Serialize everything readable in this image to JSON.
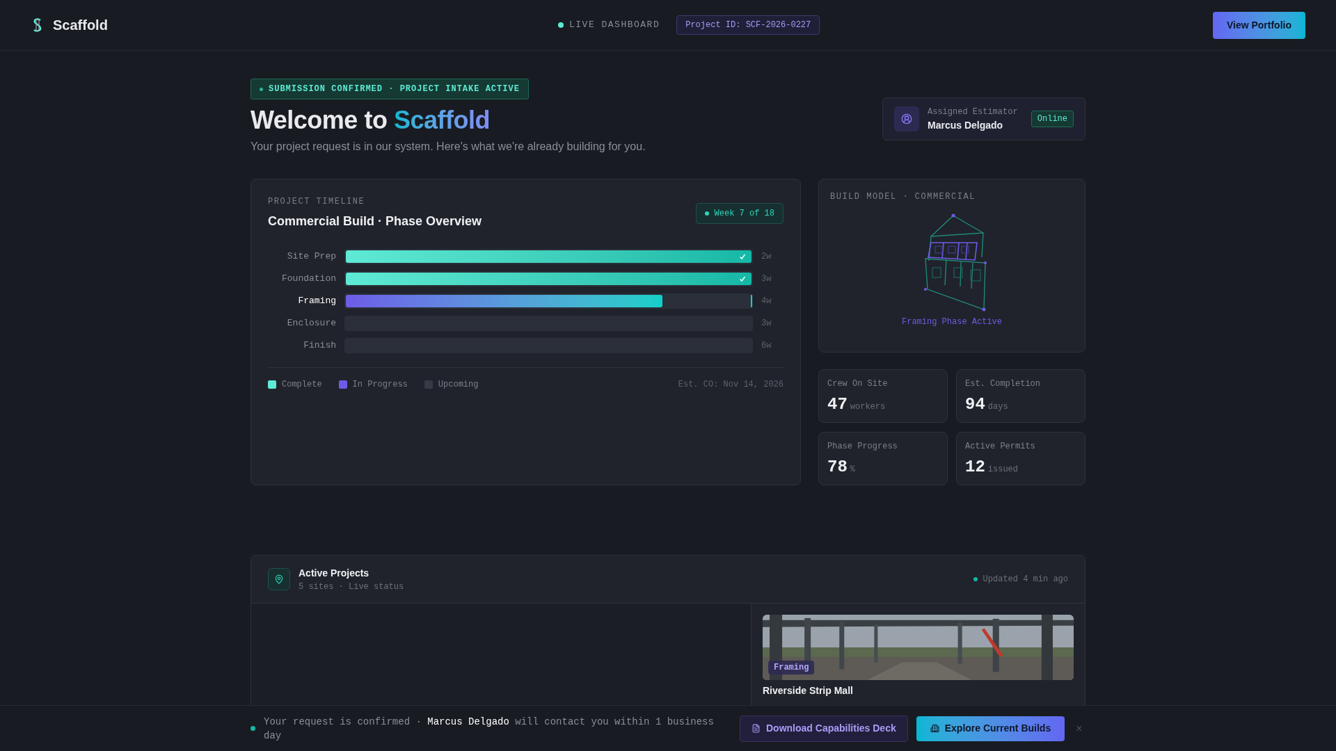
{
  "header": {
    "brand": "Scaffold",
    "live_label": "LIVE DASHBOARD",
    "project_id": "Project ID: SCF-2026-0227",
    "button": "View Portfolio"
  },
  "hero": {
    "badge": "SUBMISSION CONFIRMED · PROJECT INTAKE ACTIVE",
    "title_start": "Welcome to",
    "title_accent": "Scaffold",
    "subtitle": "Your project request is in our system. Here's what we're already building for you."
  },
  "estimator": {
    "label": "Assigned Estimator",
    "name": "Marcus Delgado",
    "status": "Online"
  },
  "timeline": {
    "eyebrow": "PROJECT TIMELINE",
    "title": "Commercial Build · Phase Overview",
    "week": "Week 7 of 18",
    "phases": [
      {
        "name": "Site Prep",
        "kind": "complete",
        "level": 1,
        "duration": "2w"
      },
      {
        "name": "Foundation",
        "kind": "complete",
        "level": 1,
        "duration": "3w"
      },
      {
        "name": "Framing",
        "kind": "in_progress",
        "level": 0.78,
        "duration": "4w"
      },
      {
        "name": "Enclosure",
        "kind": "upcoming",
        "duration": "3w"
      },
      {
        "name": "Finish",
        "kind": "upcoming",
        "duration": "6w"
      }
    ],
    "legend": [
      {
        "label": "Complete",
        "color": "#5eead4"
      },
      {
        "label": "In Progress",
        "color": "#6d5ce8"
      },
      {
        "label": "Upcoming",
        "color": "#343a46"
      }
    ],
    "est": "Est. CO: Nov 14, 2026"
  },
  "build_model": {
    "eyebrow": "BUILD MODEL · COMMERCIAL",
    "caption": "Framing Phase Active"
  },
  "stats": [
    {
      "label": "Crew On Site",
      "value": "47",
      "unit": "workers"
    },
    {
      "label": "Est. Completion",
      "value": "94",
      "unit": "days"
    },
    {
      "label": "Phase Progress",
      "value": "78",
      "unit": "%"
    },
    {
      "label": "Active Permits",
      "value": "12",
      "unit": "issued"
    }
  ],
  "projects": {
    "title": "Active Projects",
    "subtitle": "5 sites · Live status",
    "updated": "Updated 4 min ago",
    "card": {
      "tag": "Framing",
      "name": "Riverside Strip Mall"
    }
  },
  "notice": {
    "text": "Your request is confirmed · **Marcus Delgado** will contact you within 1 business day",
    "secondary": "Download Capabilities Deck",
    "primary": "Explore Current Builds",
    "close": "×"
  }
}
